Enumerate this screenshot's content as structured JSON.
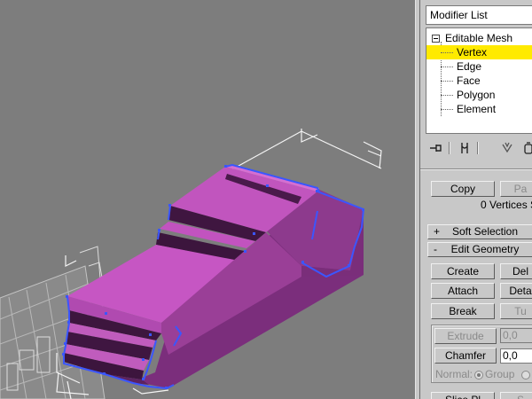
{
  "modifier_list": {
    "label": "Modifier List"
  },
  "stack": {
    "root": "Editable Mesh",
    "items": [
      "Vertex",
      "Edge",
      "Face",
      "Polygon",
      "Element"
    ],
    "selected": "Vertex"
  },
  "toolbar": {
    "icons": [
      "pin-stack-icon",
      "show-end-result-icon",
      "make-unique-icon",
      "remove-modifier-icon"
    ]
  },
  "named_selections": {
    "copy_label": "Copy",
    "paste_label": "Pa",
    "status": "0 Vertices Se"
  },
  "rollouts": {
    "soft_selection": {
      "sign": "+",
      "title": "Soft Selection"
    },
    "edit_geometry": {
      "sign": "-",
      "title": "Edit Geometry"
    }
  },
  "edit_geometry": {
    "create": "Create",
    "delete": "Del",
    "attach": "Attach",
    "detach": "Deta",
    "break": "Break",
    "turn": "Tu",
    "extrude": "Extrude",
    "extrude_value": "0,0",
    "chamfer": "Chamfer",
    "chamfer_value": "0,0",
    "normal_label": "Normal:",
    "group_label": "Group",
    "slice_plane": "Slice Pl",
    "slice": "S"
  },
  "colors": {
    "viewport_bg": "#7d7d7d",
    "mesh_face": "#bb4bb8",
    "mesh_edge": "#3b56ff",
    "selected_item": "#ffea00"
  }
}
